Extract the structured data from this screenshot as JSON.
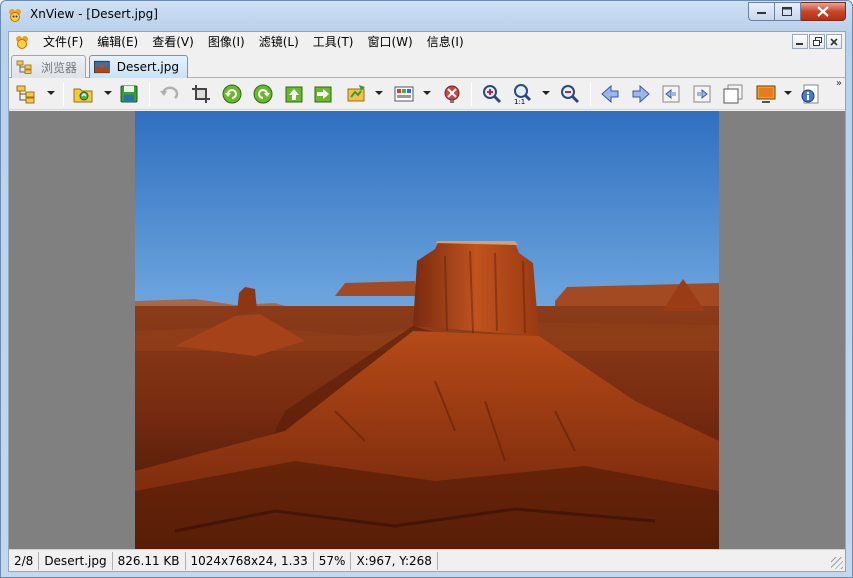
{
  "window": {
    "title": "XnView - [Desert.jpg]"
  },
  "menu": {
    "items": [
      {
        "label": "文件(F)"
      },
      {
        "label": "编辑(E)"
      },
      {
        "label": "查看(V)"
      },
      {
        "label": "图像(I)"
      },
      {
        "label": "滤镜(L)"
      },
      {
        "label": "工具(T)"
      },
      {
        "label": "窗口(W)"
      },
      {
        "label": "信息(I)"
      }
    ]
  },
  "tabs": [
    {
      "label": "浏览器",
      "active": false
    },
    {
      "label": "Desert.jpg",
      "active": true
    }
  ],
  "toolbar": {
    "icons": [
      "browser-tree-icon",
      "open-folder-icon",
      "save-icon",
      "undo-icon",
      "crop-icon",
      "rotate-left-icon",
      "rotate-right-icon",
      "flip-up-icon",
      "flip-right-icon",
      "transform-icon",
      "adjust-colors-icon",
      "filter-icon",
      "zoom-in-icon",
      "zoom-actual-icon",
      "zoom-out-icon",
      "previous-icon",
      "next-icon",
      "first-page-icon",
      "last-page-icon",
      "multi-page-icon",
      "slideshow-icon",
      "properties-icon"
    ],
    "more": "»"
  },
  "status": {
    "index": "2/8",
    "filename": "Desert.jpg",
    "filesize": "826.11 KB",
    "dimensions": "1024x768x24, 1.33",
    "zoom": "57%",
    "coords": "X:967, Y:268"
  },
  "colors": {
    "viewer_bg": "#808080",
    "active_tab": "#c8e2f6",
    "close_button": "#c7452b"
  }
}
